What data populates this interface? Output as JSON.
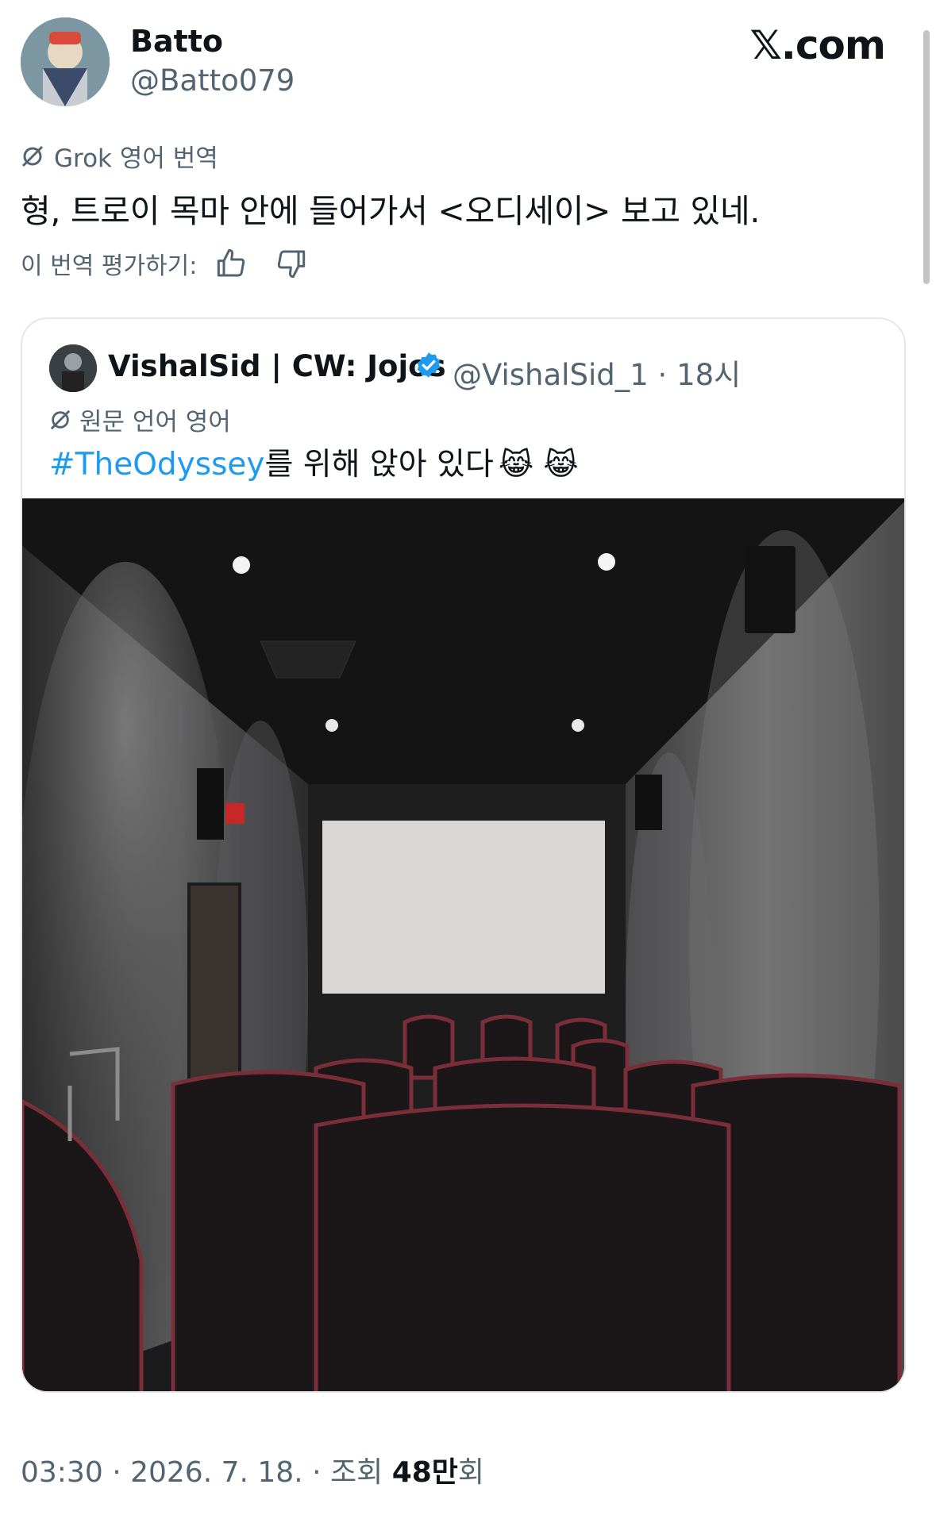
{
  "author": {
    "name": "Batto",
    "handle": "@Batto079",
    "avatar_icon": "avatar-icon"
  },
  "site_logo": "𝕏.com",
  "translation": {
    "label": "Grok 영어 번역",
    "text": "형, 트로이 목마 안에 들어가서 <오디세이> 보고 있네.",
    "rate_label": "이 번역 평가하기:"
  },
  "quoted": {
    "name": "VishalSid | CW: Jojos",
    "handle": "@VishalSid_1",
    "time": "18시",
    "source_label": "원문 언어 영어",
    "hashtag": "#TheOdyssey",
    "text": "를 위해 앉아 있다",
    "emojis": "😹 😹",
    "verified_color": "#1d9bf0"
  },
  "footer": {
    "time": "03:30",
    "date": "2026. 7. 18.",
    "views_label": "조회",
    "views_count": "48만",
    "views_suffix": "회"
  },
  "colors": {
    "text_primary": "#0f1419",
    "text_secondary": "#536471",
    "link": "#1d9bf0",
    "border": "#e3e7ea"
  }
}
